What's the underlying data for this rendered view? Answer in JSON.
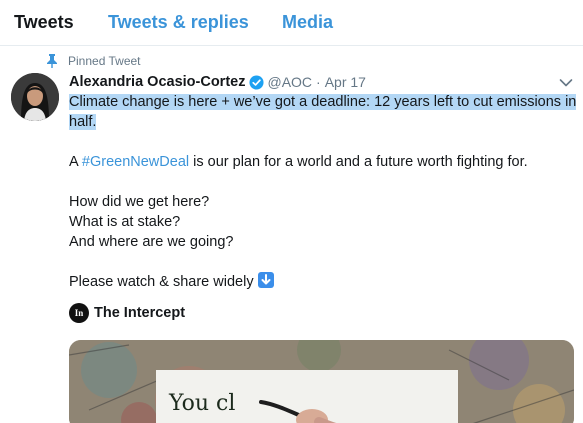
{
  "tabs": [
    {
      "label": "Tweets"
    },
    {
      "label": "Tweets & replies"
    },
    {
      "label": "Media"
    }
  ],
  "pinned_label": "Pinned Tweet",
  "tweet": {
    "author_name": "Alexandria Ocasio-Cortez",
    "handle": "@AOC",
    "separator": "·",
    "date": "Apr 17",
    "line1": "Climate change is here + we’ve got a deadline: 12 years left to cut emissions in",
    "line2": "half.",
    "line3_prefix": "A ",
    "hashtag": "#GreenNewDeal",
    "line3_suffix": " is our plan for a world and a future worth fighting for.",
    "line4": "How did we get here?",
    "line5": "What is at stake?",
    "line6": "And where are we going?",
    "line7": "Please watch & share widely"
  },
  "card": {
    "logo_text": "In",
    "author": "The Intercept",
    "media_text": "You cl"
  },
  "colors": {
    "link": "#3b94d9",
    "highlight": "#b3d7f5",
    "muted": "#657786"
  }
}
